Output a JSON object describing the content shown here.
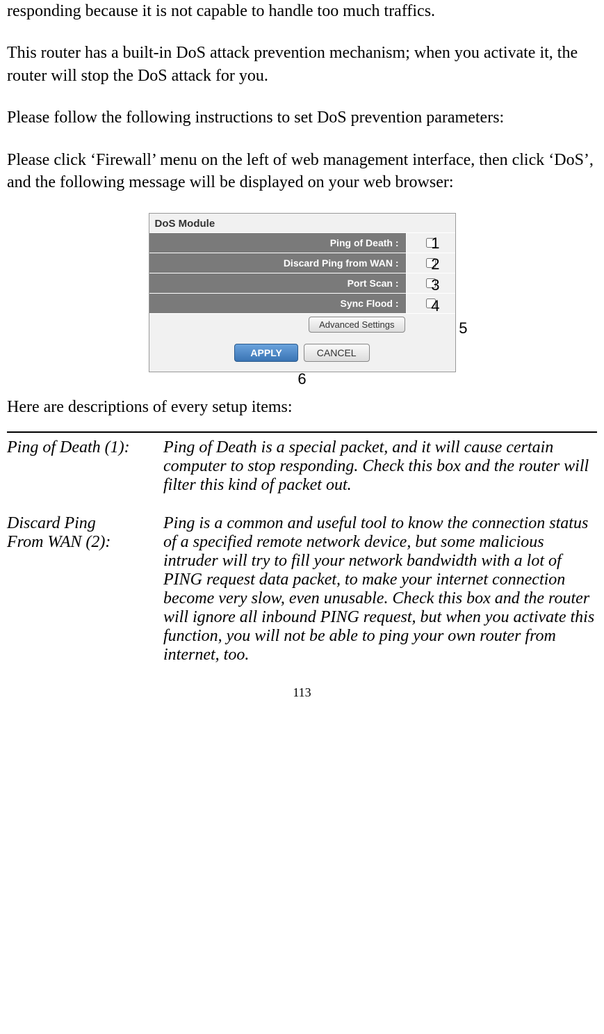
{
  "paragraphs": {
    "p0": "responding because it is not capable to handle too much traffics.",
    "p1": "This router has a built-in DoS attack prevention mechanism; when you activate it, the router will stop the DoS attack for you.",
    "p2": "Please follow the following instructions to set DoS prevention parameters:",
    "p3": "Please click ‘Firewall’ menu on the left of web management interface, then click ‘DoS’, and the following message will be displayed on your web browser:"
  },
  "screenshot": {
    "title": "DoS Module",
    "rows": [
      {
        "label": "Ping of Death :",
        "annotation": "1"
      },
      {
        "label": "Discard Ping from WAN :",
        "annotation": "2"
      },
      {
        "label": "Port Scan :",
        "annotation": "3"
      },
      {
        "label": "Sync Flood :",
        "annotation": "4"
      }
    ],
    "advanced_label": "Advanced Settings",
    "advanced_annotation": "5",
    "apply_label": "APPLY",
    "cancel_label": "CANCEL",
    "apply_annotation": "6"
  },
  "items_intro": "Here are descriptions of every setup items:",
  "descriptions": {
    "d1_label": "Ping of Death (1):",
    "d1_content": "Ping of Death is a special packet, and it will cause certain computer to stop responding. Check this box and the router will filter this kind of packet out.",
    "d2_label_line1": "Discard Ping",
    "d2_label_line2": "From WAN (2):",
    "d2_content_line1": "Ping is a common and useful tool to know",
    "d2_content_rest": "the connection status of a specified remote network device, but some malicious intruder will try to fill your network bandwidth with a lot of PING request data packet, to make your internet connection become very slow, even unusable. Check this box and the router will ignore all inbound PING request, but when you activate this function, you will not be able to ping your own router from internet, too."
  },
  "page_number": "113"
}
